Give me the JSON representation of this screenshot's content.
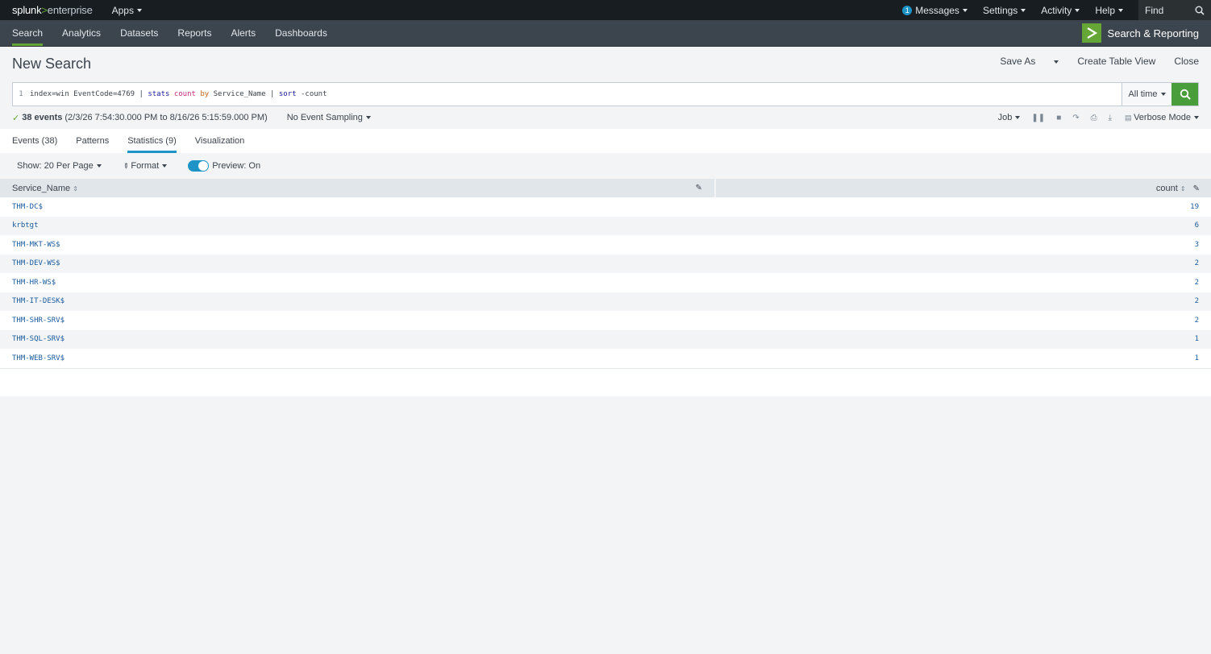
{
  "topbar": {
    "logo_main": "splunk",
    "logo_gt": ">",
    "logo_sub": "enterprise",
    "apps": "Apps",
    "messages_count": "1",
    "messages": "Messages",
    "settings": "Settings",
    "activity": "Activity",
    "help": "Help",
    "find": "Find"
  },
  "nav": {
    "items": [
      "Search",
      "Analytics",
      "Datasets",
      "Reports",
      "Alerts",
      "Dashboards"
    ],
    "app_title": "Search & Reporting"
  },
  "header": {
    "title": "New Search",
    "save_as": "Save As",
    "create_table_view": "Create Table View",
    "close": "Close"
  },
  "search": {
    "line_number": "1",
    "query_parts": {
      "p1": "index=win EventCode=4769 | ",
      "p2": "stats",
      "p3": " ",
      "p4": "count",
      "p5": " ",
      "p6": "by",
      "p7": " Service_Name | ",
      "p8": "sort",
      "p9": " -count"
    },
    "time_range": "All time"
  },
  "status": {
    "events": "38 events",
    "range": "(2/3/26 7:54:30.000 PM to 8/16/26 5:15:59.000 PM)",
    "sampling": "No Event Sampling",
    "job": "Job",
    "mode": "Verbose Mode"
  },
  "tabs": [
    "Events (38)",
    "Patterns",
    "Statistics (9)",
    "Visualization"
  ],
  "controls": {
    "show": "Show: 20 Per Page",
    "format": "Format",
    "preview": "Preview: On"
  },
  "table": {
    "columns": [
      "Service_Name",
      "count"
    ],
    "rows": [
      [
        "THM-DC$",
        "19"
      ],
      [
        "krbtgt",
        "6"
      ],
      [
        "THM-MKT-WS$",
        "3"
      ],
      [
        "THM-DEV-WS$",
        "2"
      ],
      [
        "THM-HR-WS$",
        "2"
      ],
      [
        "THM-IT-DESK$",
        "2"
      ],
      [
        "THM-SHR-SRV$",
        "2"
      ],
      [
        "THM-SQL-SRV$",
        "1"
      ],
      [
        "THM-WEB-SRV$",
        "1"
      ]
    ]
  },
  "colors": {
    "brand_green": "#65a637",
    "accent_blue": "#1e93c6"
  }
}
